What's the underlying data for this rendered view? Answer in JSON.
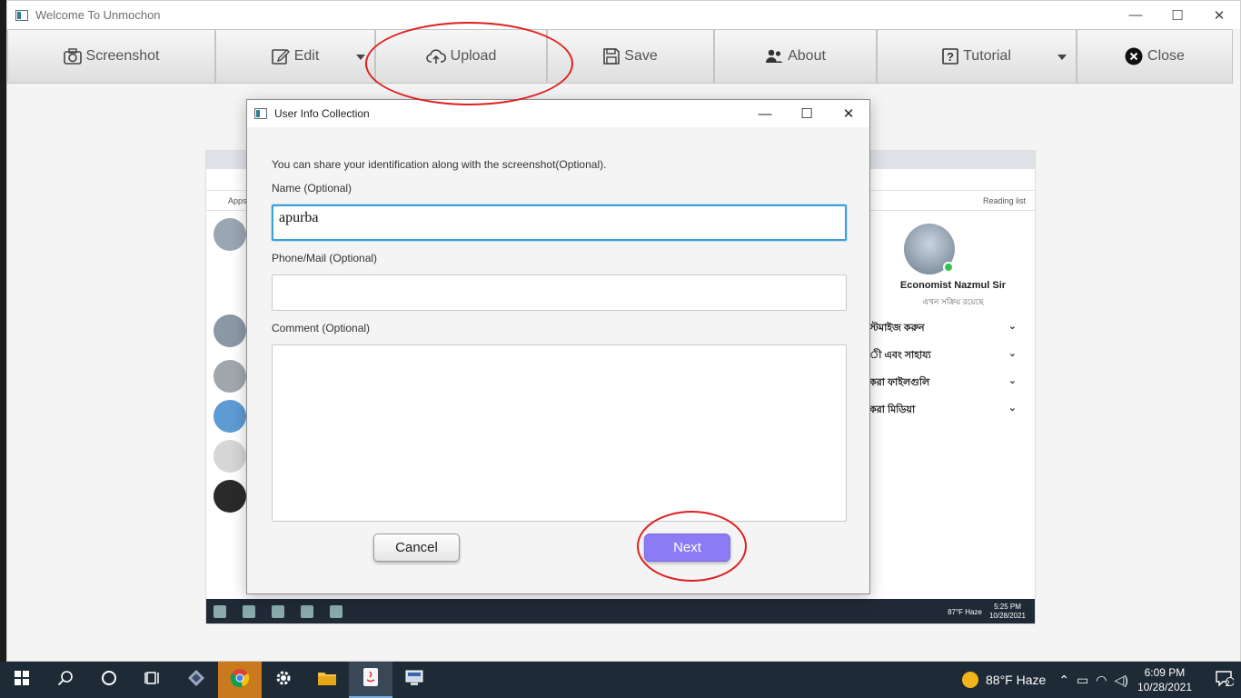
{
  "app": {
    "title": "Welcome To Unmochon",
    "controls": {
      "minimize": "—",
      "maximize": "☐",
      "close": "✕"
    }
  },
  "toolbar": {
    "screenshot": "Screenshot",
    "edit": "Edit",
    "upload": "Upload",
    "save": "Save",
    "about": "About",
    "tutorial": "Tutorial",
    "close": "Close"
  },
  "preview": {
    "bookmarks_label": "Apps",
    "reading_list": "Reading list",
    "profile_name": "Economist Nazmul Sir",
    "profile_status": "এখন সক্রিয় রয়েছে",
    "menu_items": [
      "স্টমাইজ করুন",
      "ী এবং সাহায্য",
      "করা ফাইলগুলি",
      "করা মিডিয়া"
    ],
    "tray_weather": "87°F Haze",
    "tray_time": "5:25 PM",
    "tray_date": "10/28/2021"
  },
  "dialog": {
    "title": "User Info Collection",
    "intro": "You can share your identification along with the screenshot(Optional).",
    "name_label": "Name (Optional)",
    "name_value": "apurba",
    "phone_label": "Phone/Mail (Optional)",
    "phone_value": "",
    "comment_label": "Comment (Optional)",
    "comment_value": "",
    "cancel": "Cancel",
    "next": "Next",
    "controls": {
      "minimize": "—",
      "maximize": "☐",
      "close": "✕"
    }
  },
  "taskbar": {
    "weather": "88°F  Haze",
    "time": "6:09 PM",
    "date": "10/28/2021",
    "notifications": "2"
  },
  "colors": {
    "next_button": "#8b7cf5",
    "focus_border": "#3aa0d8",
    "annotation_ring": "#e01f1f"
  }
}
